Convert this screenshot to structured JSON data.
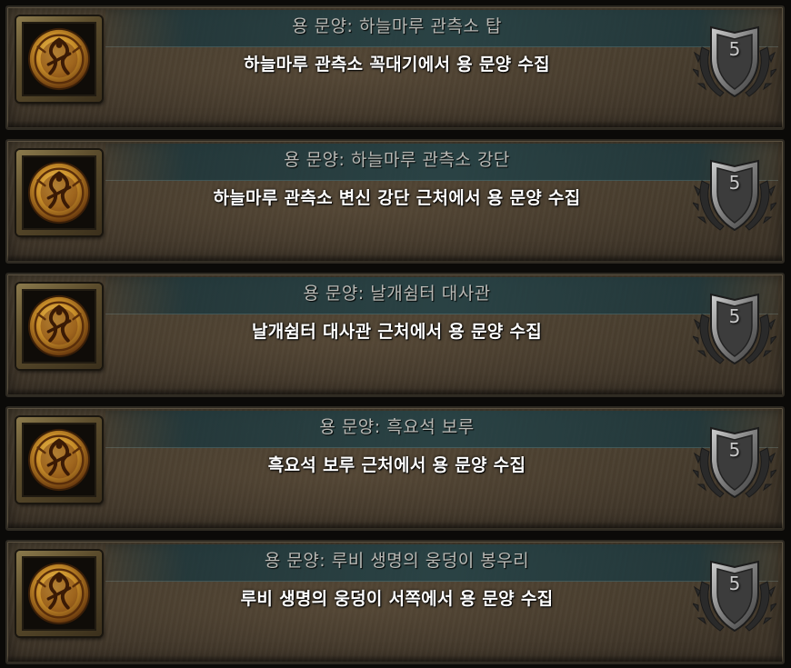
{
  "achievements": [
    {
      "title": "용 문양: 하늘마루 관측소 탑",
      "description": "하늘마루 관측소 꼭대기에서 용 문양 수집",
      "points": "5",
      "icon": "dragon-glyph-icon"
    },
    {
      "title": "용 문양: 하늘마루 관측소 강단",
      "description": "하늘마루 관측소 변신 강단 근처에서 용 문양 수집",
      "points": "5",
      "icon": "dragon-glyph-icon"
    },
    {
      "title": "용 문양: 날개쉼터 대사관",
      "description": "날개쉼터 대사관 근처에서 용 문양 수집",
      "points": "5",
      "icon": "dragon-glyph-icon"
    },
    {
      "title": "용 문양: 흑요석 보루",
      "description": "흑요석 보루 근처에서 용 문양 수집",
      "points": "5",
      "icon": "dragon-glyph-icon"
    },
    {
      "title": "용 문양: 루비 생명의 웅덩이 봉우리",
      "description": "루비 생명의 웅덩이 서쪽에서 용 문양 수집",
      "points": "5",
      "icon": "dragon-glyph-icon"
    }
  ],
  "colors": {
    "title_text": "#b9b9b5",
    "description_text": "#ffffff",
    "medallion_gold": "#d4a03a",
    "medallion_dark": "#6a3a0e",
    "shield_silver": "#8d8d8d"
  }
}
